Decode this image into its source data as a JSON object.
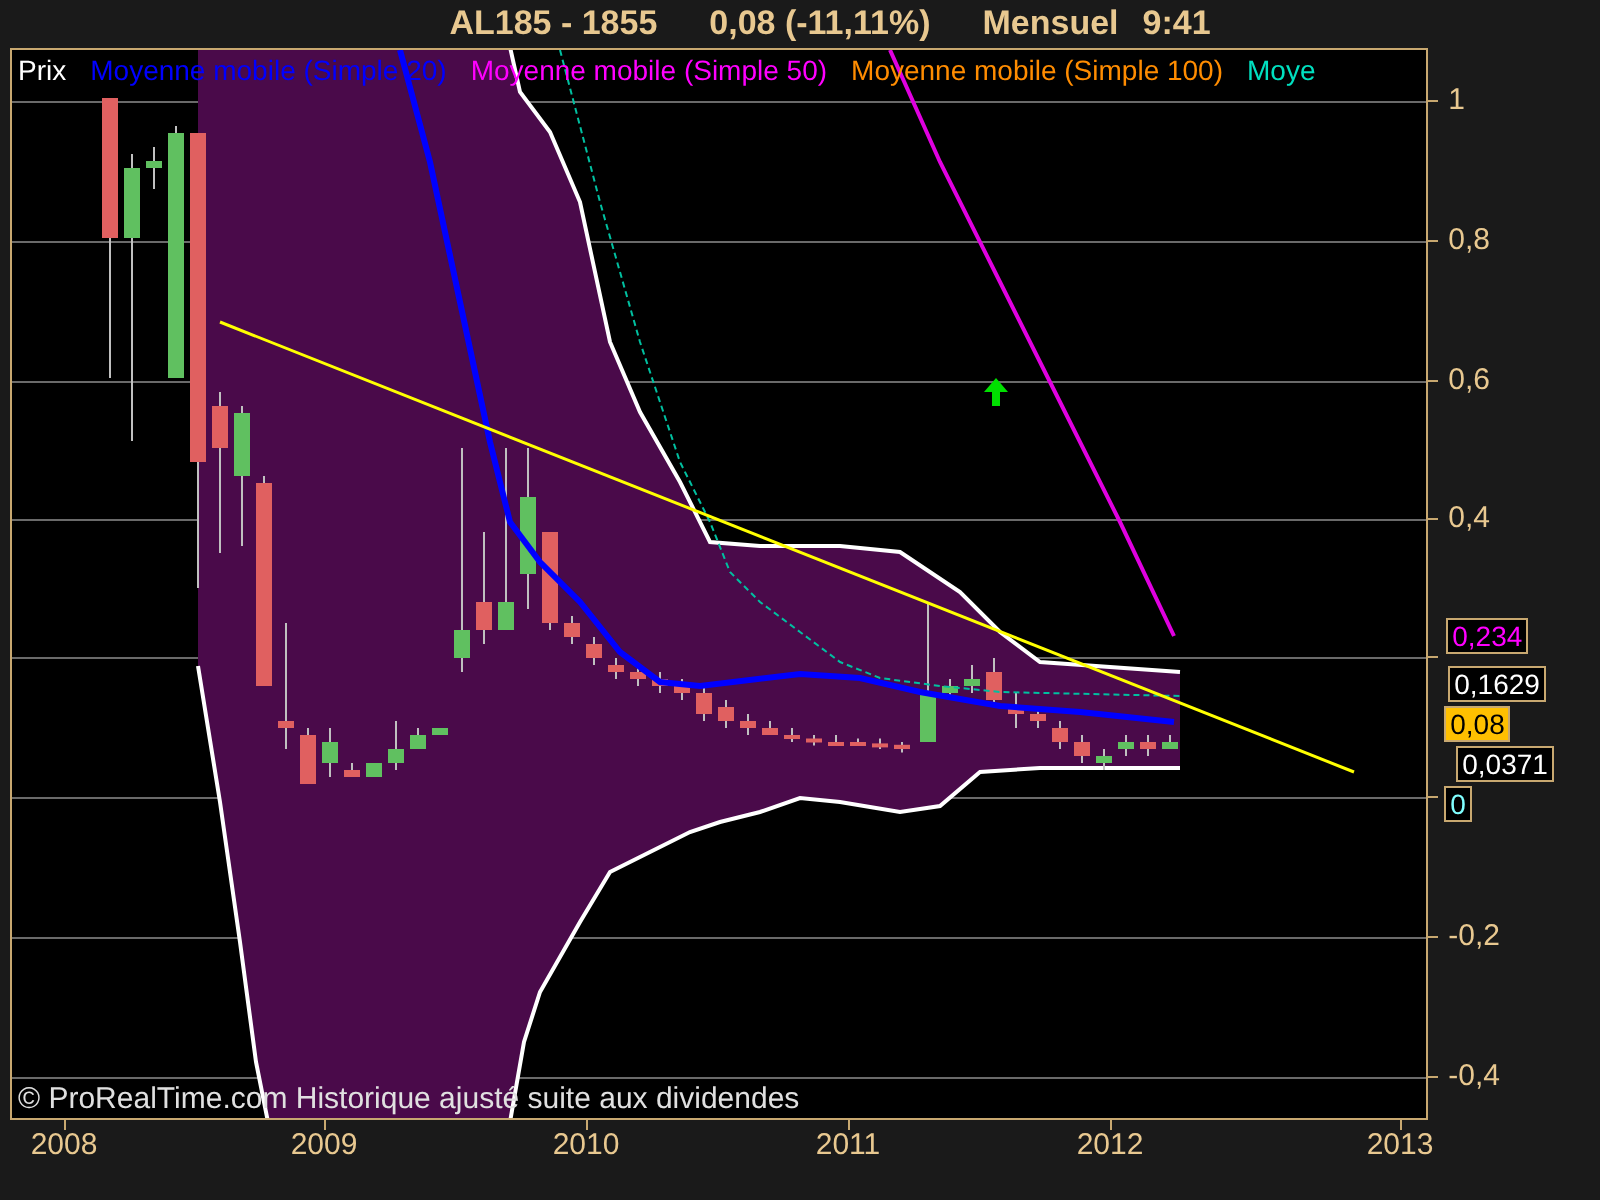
{
  "header": {
    "symbol": "AL185 - 1855",
    "quote": "0,08 (-11,11%)",
    "period": "Mensuel",
    "time": "9:41"
  },
  "legend": [
    {
      "label": "Prix",
      "color": "#ffffff"
    },
    {
      "label": "Moyenne mobile (Simple 20)",
      "color": "#0000ff"
    },
    {
      "label": "Moyenne mobile (Simple 50)",
      "color": "#ff00ff"
    },
    {
      "label": "Moyenne mobile (Simple 100)",
      "color": "#ff8c00"
    },
    {
      "label": "Moye",
      "color": "#00e0c0"
    }
  ],
  "y_axis": {
    "labels": [
      "1",
      "0,8",
      "0,6",
      "0,4",
      "-0,2",
      "-0,4"
    ]
  },
  "value_badges": [
    {
      "label": "0,234",
      "color": "#ff00ff",
      "kind": "outline"
    },
    {
      "label": "0,1629",
      "color": "#ffffff",
      "kind": "outline"
    },
    {
      "label": "0,08",
      "color": "#ffc000",
      "kind": "filled"
    },
    {
      "label": "0,0371",
      "color": "#ffffff",
      "kind": "outline"
    },
    {
      "label": "0",
      "color": "#80ffff",
      "kind": "outline"
    }
  ],
  "x_axis": {
    "labels": [
      "2008",
      "2009",
      "2010",
      "2011",
      "2012",
      "2013"
    ]
  },
  "footnote": "© ProRealTime.com Historique ajusté suite aux dividendes"
}
